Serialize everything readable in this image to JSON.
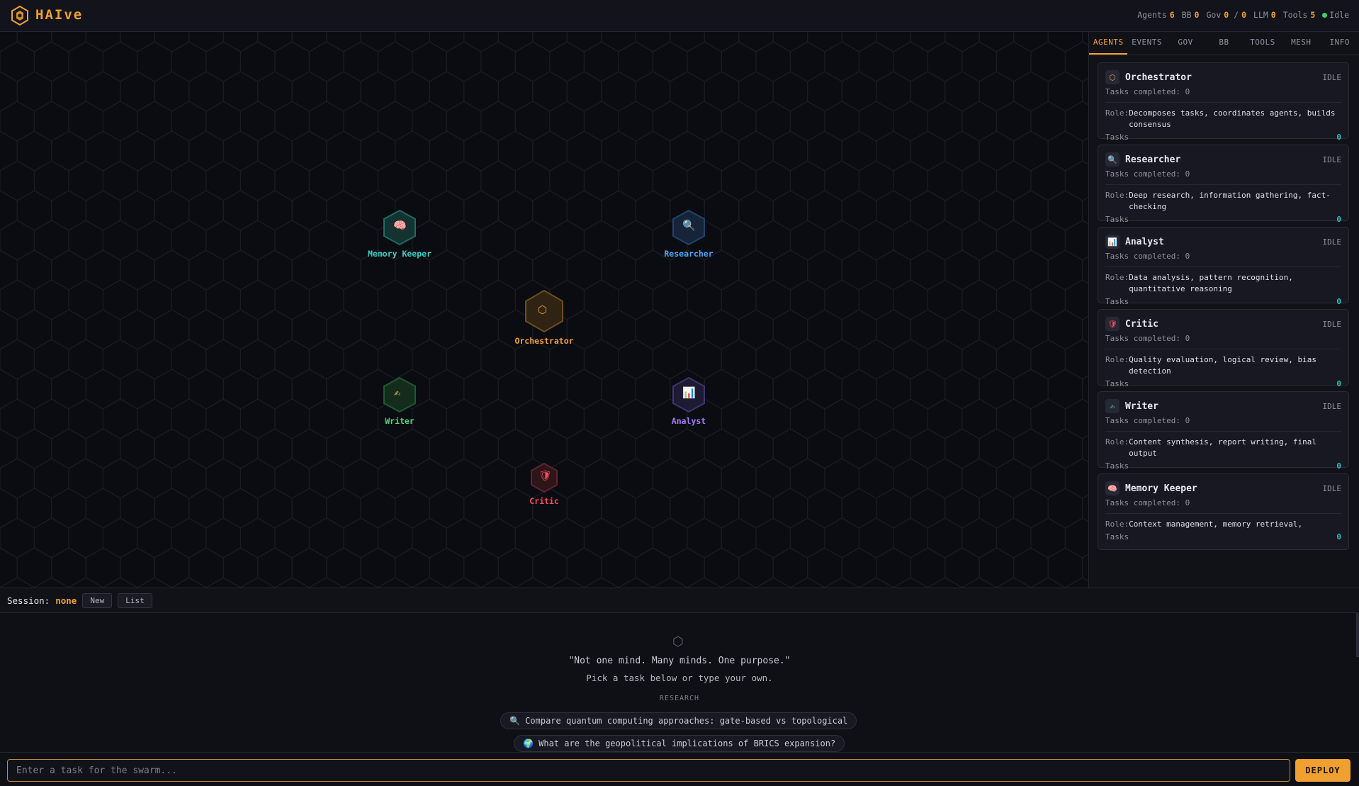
{
  "app": {
    "brand": "HAIve"
  },
  "stats": {
    "agents_label": "Agents",
    "agents": "6",
    "bb_label": "BB",
    "bb": "0",
    "gov_label": "Gov",
    "gov_a": "0",
    "gov_sep": "/",
    "gov_b": "0",
    "llm_label": "LLM",
    "llm": "0",
    "tools_label": "Tools",
    "tools": "5",
    "status": "Idle"
  },
  "graph": {
    "nodes": [
      {
        "name": "Memory Keeper",
        "glyph": "🧠",
        "color": "#3ad1c6"
      },
      {
        "name": "Researcher",
        "glyph": "🔍",
        "color": "#4aa8ff"
      },
      {
        "name": "Orchestrator",
        "glyph": "⬡",
        "color": "#f0a030"
      },
      {
        "name": "Writer",
        "glyph": "✍",
        "color": "#4ddc7a"
      },
      {
        "name": "Analyst",
        "glyph": "📊",
        "color": "#a57bff"
      },
      {
        "name": "Critic",
        "glyph": "🛡",
        "color": "#ff4d5e"
      }
    ]
  },
  "panel": {
    "tabs": [
      "AGENTS",
      "EVENTS",
      "GOV",
      "BB",
      "TOOLS",
      "MESH",
      "INFO"
    ],
    "active_tab": "AGENTS",
    "cards": [
      {
        "icon": "⬡",
        "name": "Orchestrator",
        "status": "IDLE",
        "completed": "Tasks completed: 0",
        "role_key": "Role:",
        "role": "Decomposes tasks, coordinates agents, builds consensus",
        "tasks_label": "Tasks",
        "tasks": "0"
      },
      {
        "icon": "🔍",
        "name": "Researcher",
        "status": "IDLE",
        "completed": "Tasks completed: 0",
        "role_key": "Role:",
        "role": "Deep research, information gathering, fact-checking",
        "tasks_label": "Tasks",
        "tasks": "0"
      },
      {
        "icon": "📊",
        "name": "Analyst",
        "status": "IDLE",
        "completed": "Tasks completed: 0",
        "role_key": "Role:",
        "role": "Data analysis, pattern recognition, quantitative reasoning",
        "tasks_label": "Tasks",
        "tasks": "0"
      },
      {
        "icon": "🛡",
        "name": "Critic",
        "status": "IDLE",
        "completed": "Tasks completed: 0",
        "role_key": "Role:",
        "role": "Quality evaluation, logical review, bias detection",
        "tasks_label": "Tasks",
        "tasks": "0"
      },
      {
        "icon": "✍",
        "name": "Writer",
        "status": "IDLE",
        "completed": "Tasks completed: 0",
        "role_key": "Role:",
        "role": "Content synthesis, report writing, final output",
        "tasks_label": "Tasks",
        "tasks": "0"
      },
      {
        "icon": "🧠",
        "name": "Memory Keeper",
        "status": "IDLE",
        "completed": "Tasks completed: 0",
        "role_key": "Role:",
        "role": "Context management, memory retrieval,",
        "tasks_label": "Tasks",
        "tasks": "0"
      }
    ]
  },
  "session": {
    "label": "Session:",
    "value": "none",
    "new_label": "New",
    "list_label": "List"
  },
  "welcome": {
    "icon": "⬡",
    "quote": "\"Not one mind. Many minds. One purpose.\"",
    "pick": "Pick a task below or type your own.",
    "category": "RESEARCH",
    "suggestions": [
      "🔍 Compare quantum computing approaches: gate-based vs topological",
      "🌍 What are the geopolitical implications of BRICS expansion?"
    ]
  },
  "input": {
    "placeholder": "Enter a task for the swarm...",
    "deploy_label": "DEPLOY"
  }
}
